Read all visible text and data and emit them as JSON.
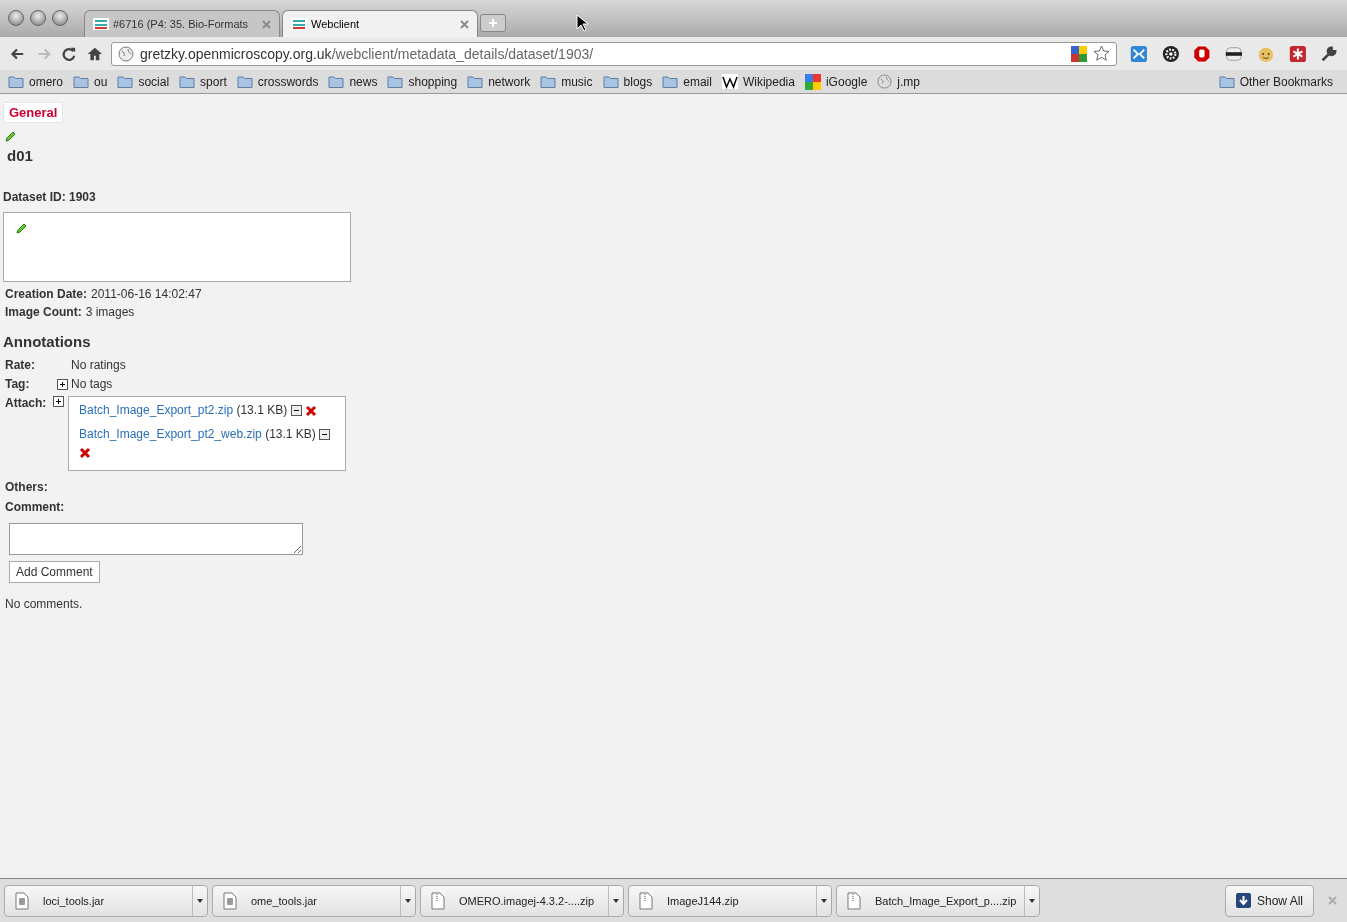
{
  "tabs": [
    {
      "title": "#6716 (P4: 35. Bio-Formats",
      "selected": false
    },
    {
      "title": "Webclient",
      "selected": true
    }
  ],
  "address": {
    "host": "gretzky.openmicroscopy.org.uk",
    "path": "/webclient/metadata_details/dataset/1903/"
  },
  "bookmarks": [
    {
      "label": "omero",
      "kind": "folder"
    },
    {
      "label": "ou",
      "kind": "folder"
    },
    {
      "label": "social",
      "kind": "folder"
    },
    {
      "label": "sport",
      "kind": "folder"
    },
    {
      "label": "crosswords",
      "kind": "folder"
    },
    {
      "label": "news",
      "kind": "folder"
    },
    {
      "label": "shopping",
      "kind": "folder"
    },
    {
      "label": "network",
      "kind": "folder"
    },
    {
      "label": "music",
      "kind": "folder"
    },
    {
      "label": "blogs",
      "kind": "folder"
    },
    {
      "label": "email",
      "kind": "folder"
    },
    {
      "label": "Wikipedia",
      "kind": "wiki"
    },
    {
      "label": "iGoogle",
      "kind": "google"
    },
    {
      "label": "j.mp",
      "kind": "globe"
    }
  ],
  "other_bookmarks": "Other Bookmarks",
  "page": {
    "tabs": [
      {
        "label": "General",
        "selected": true
      }
    ],
    "name": "d01",
    "dataset_id": "Dataset ID: 1903",
    "creation": {
      "label": "Creation Date:",
      "value": "2011-06-16 14:02:47"
    },
    "image_count": {
      "label": "Image Count:",
      "value": "3 images"
    },
    "annotations_heading": "Annotations",
    "rate": {
      "label": "Rate:",
      "value": "No ratings"
    },
    "tag": {
      "label": "Tag:",
      "value": "No tags"
    },
    "attach_label": "Attach:",
    "attachments": [
      {
        "name": "Batch_Image_Export_pt2.zip",
        "size": "(13.1 KB)"
      },
      {
        "name": "Batch_Image_Export_pt2_web.zip",
        "size": "(13.1 KB)"
      }
    ],
    "others_label": "Others:",
    "comment_label": "Comment:",
    "add_comment": "Add Comment",
    "no_comments": "No comments."
  },
  "downloads": [
    {
      "name": "loci_tools.jar",
      "kind": "jar"
    },
    {
      "name": "ome_tools.jar",
      "kind": "jar"
    },
    {
      "name": "OMERO.imagej-4.3.2-....zip",
      "kind": "zip"
    },
    {
      "name": "ImageJ144.zip",
      "kind": "zip"
    },
    {
      "name": "Batch_Image_Export_p....zip",
      "kind": "zip"
    }
  ],
  "show_all": "Show All"
}
